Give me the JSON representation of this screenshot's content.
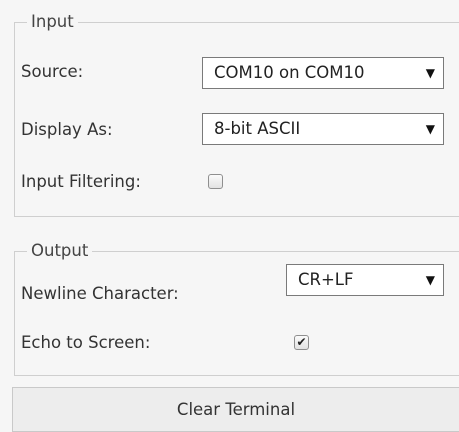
{
  "input_section": {
    "legend": "Input",
    "source_label": "Source:",
    "source_value": "COM10 on COM10",
    "display_as_label": "Display As:",
    "display_as_value": "8-bit ASCII",
    "filtering_label": "Input Filtering:",
    "filtering_checked": false
  },
  "output_section": {
    "legend": "Output",
    "newline_label": "Newline Character:",
    "newline_value": "CR+LF",
    "echo_label": "Echo to Screen:",
    "echo_checked": true
  },
  "actions": {
    "clear_label": "Clear Terminal"
  },
  "icons": {
    "dropdown": "dropdown-arrow-icon",
    "check": "checkmark-icon"
  }
}
